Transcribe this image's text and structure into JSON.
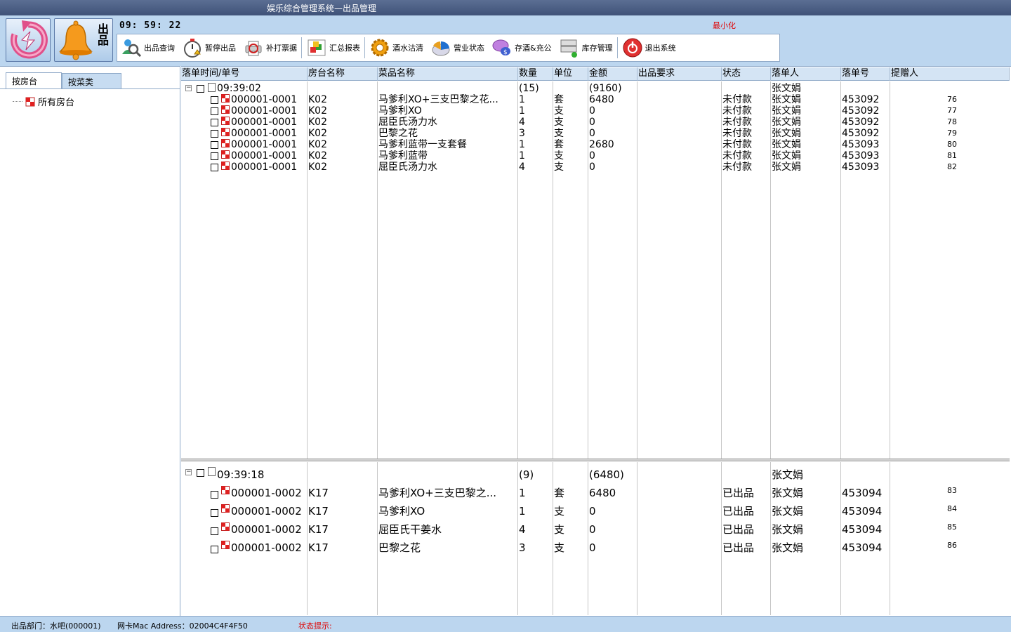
{
  "window": {
    "title": "娱乐综合管理系统—出品管理"
  },
  "header": {
    "clock": "09: 59: 22",
    "minimize_label": "最小化",
    "bell_label": "出品"
  },
  "toolbar": {
    "items": [
      {
        "label": "出品查询",
        "icon": "search-people-icon"
      },
      {
        "label": "暂停出品",
        "icon": "stopwatch-icon"
      },
      {
        "label": "补打票据",
        "icon": "printer-icon"
      },
      {
        "label": "汇总报表",
        "icon": "report-cubes-icon"
      },
      {
        "label": "酒水沽清",
        "icon": "gear-icon"
      },
      {
        "label": "营业状态",
        "icon": "pie-chart-icon"
      },
      {
        "label": "存酒&充公",
        "icon": "chat-icon"
      },
      {
        "label": "库存管理",
        "icon": "server-icon"
      },
      {
        "label": "退出系统",
        "icon": "power-icon"
      }
    ]
  },
  "left": {
    "tabs": [
      "按房台",
      "按菜类"
    ],
    "tree_root": "所有房台"
  },
  "grid": {
    "columns": [
      "落单时间/单号",
      "房台名称",
      "菜品名称",
      "数量",
      "单位",
      "金额",
      "出品要求",
      "状态",
      "落单人",
      "落单号",
      "提赠人"
    ],
    "sections": [
      {
        "time": "09:39:02",
        "qty_total": "(15)",
        "amount_total": "(9160)",
        "person": "张文娟",
        "rows": [
          {
            "order": "000001-0001",
            "room": "K02",
            "dish": "马爹利XO+三支巴黎之花...",
            "qty": "1",
            "unit": "套",
            "amount": "6480",
            "req": "",
            "status": "未付款",
            "person": "张文娟",
            "order_no": "453092",
            "seq": "76"
          },
          {
            "order": "000001-0001",
            "room": "K02",
            "dish": "马爹利XO",
            "qty": "1",
            "unit": "支",
            "amount": "0",
            "req": "",
            "status": "未付款",
            "person": "张文娟",
            "order_no": "453092",
            "seq": "77"
          },
          {
            "order": "000001-0001",
            "room": "K02",
            "dish": "屈臣氏汤力水",
            "qty": "4",
            "unit": "支",
            "amount": "0",
            "req": "",
            "status": "未付款",
            "person": "张文娟",
            "order_no": "453092",
            "seq": "78"
          },
          {
            "order": "000001-0001",
            "room": "K02",
            "dish": "巴黎之花",
            "qty": "3",
            "unit": "支",
            "amount": "0",
            "req": "",
            "status": "未付款",
            "person": "张文娟",
            "order_no": "453092",
            "seq": "79"
          },
          {
            "order": "000001-0001",
            "room": "K02",
            "dish": "马爹利蓝带一支套餐",
            "qty": "1",
            "unit": "套",
            "amount": "2680",
            "req": "",
            "status": "未付款",
            "person": "张文娟",
            "order_no": "453093",
            "seq": "80"
          },
          {
            "order": "000001-0001",
            "room": "K02",
            "dish": "马爹利蓝带",
            "qty": "1",
            "unit": "支",
            "amount": "0",
            "req": "",
            "status": "未付款",
            "person": "张文娟",
            "order_no": "453093",
            "seq": "81"
          },
          {
            "order": "000001-0001",
            "room": "K02",
            "dish": "屈臣氏汤力水",
            "qty": "4",
            "unit": "支",
            "amount": "0",
            "req": "",
            "status": "未付款",
            "person": "张文娟",
            "order_no": "453093",
            "seq": "82"
          }
        ]
      },
      {
        "time": "09:39:18",
        "qty_total": "(9)",
        "amount_total": "(6480)",
        "person": "张文娟",
        "rows": [
          {
            "order": "000001-0002",
            "room": "K17",
            "dish": "马爹利XO+三支巴黎之...",
            "qty": "1",
            "unit": "套",
            "amount": "6480",
            "req": "",
            "status": "已出品",
            "person": "张文娟",
            "order_no": "453094",
            "seq": "83"
          },
          {
            "order": "000001-0002",
            "room": "K17",
            "dish": "马爹利XO",
            "qty": "1",
            "unit": "支",
            "amount": "0",
            "req": "",
            "status": "已出品",
            "person": "张文娟",
            "order_no": "453094",
            "seq": "84"
          },
          {
            "order": "000001-0002",
            "room": "K17",
            "dish": "屈臣氏干姜水",
            "qty": "4",
            "unit": "支",
            "amount": "0",
            "req": "",
            "status": "已出品",
            "person": "张文娟",
            "order_no": "453094",
            "seq": "85"
          },
          {
            "order": "000001-0002",
            "room": "K17",
            "dish": "巴黎之花",
            "qty": "3",
            "unit": "支",
            "amount": "0",
            "req": "",
            "status": "已出品",
            "person": "张文娟",
            "order_no": "453094",
            "seq": "86"
          }
        ]
      }
    ]
  },
  "statusbar": {
    "dept": "出品部门：水吧(000001)",
    "mac": "网卡Mac Address：02004C4F4F50",
    "hint": "状态提示:"
  },
  "colors": {
    "titlebar": "#4a5d83",
    "header_bg": "#bcd6ef",
    "alert_red": "#e00000",
    "grid_header": "#d4e4f4"
  }
}
